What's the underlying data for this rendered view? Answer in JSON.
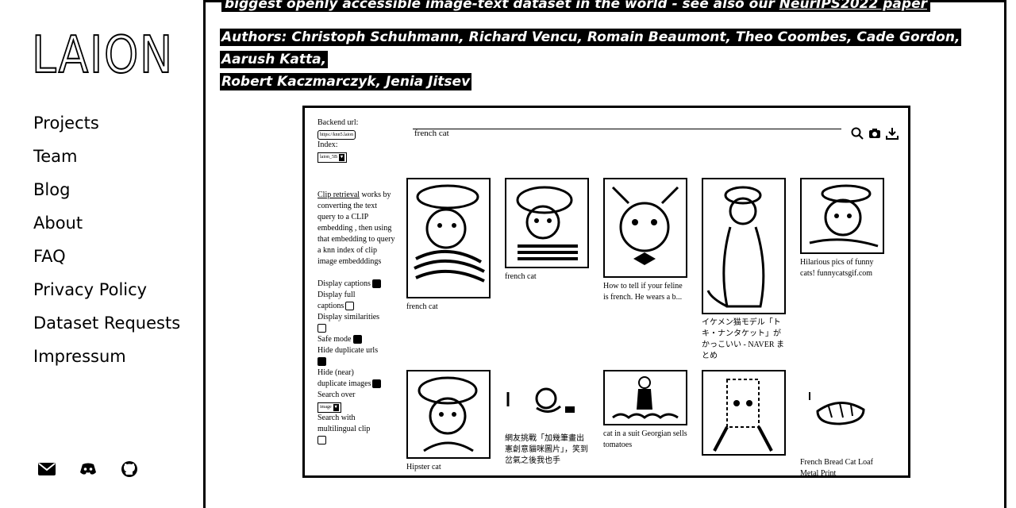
{
  "sidebar": {
    "logo": "LAION",
    "nav": [
      "Projects",
      "Team",
      "Blog",
      "About",
      "FAQ",
      "Privacy Policy",
      "Dataset Requests",
      "Impressum"
    ],
    "social_icons": [
      "mail-icon",
      "discord-icon",
      "github-icon"
    ]
  },
  "article": {
    "intro_text": "biggest openly accessible image-text dataset in the world - see also our ",
    "intro_link": "NeurIPS2022 paper",
    "authors_line1": "Authors: Christoph Schuhmann, Richard Vencu, Romain Beaumont, Theo Coombes, Cade Gordon, Aarush Katta,",
    "authors_line2": "Robert Kaczmarczyk, Jenia Jitsev"
  },
  "figure": {
    "backend_label": "Backend url:",
    "backend_value": "https://knn5.laion",
    "index_label": "Index:",
    "index_value": "laion_5B",
    "query": "french cat",
    "blurb_link": "Clip retrieval",
    "blurb_text": " works by converting the text query to a CLIP embedding , then using that embedding to query a knn index of clip image embedddings",
    "options": {
      "display_captions": "Display captions",
      "display_full": "Display full",
      "captions": "captions",
      "display_similarities": "Display similarities",
      "safe_mode": "Safe mode",
      "hide_duplicate_urls": "Hide duplicate urls",
      "hide_near": "Hide (near)",
      "duplicate_images": "duplicate images",
      "search_over": "Search over",
      "search_over_value": "image",
      "search_with": "Search with",
      "multilingual": "multilingual clip"
    },
    "results": [
      {
        "caption": "french cat"
      },
      {
        "caption": "french cat"
      },
      {
        "caption": "How to tell if your feline is french. He wears a b..."
      },
      {
        "caption": "イケメン猫モデル「トキ・ナンタケット」がかっこいい - NAVER まとめ"
      },
      {
        "caption": "Hilarious pics of funny cats! funnycatsgif.com"
      },
      {
        "caption": "Hipster cat"
      },
      {
        "caption": "網友挑戰「加幾筆畫出憲創意貓咪圖片」，笑到岔氣之後我也手"
      },
      {
        "caption": "cat in a suit Georgian sells tomatoes"
      },
      {
        "caption": ""
      },
      {
        "caption": "French Bread Cat Loaf Metal Print"
      }
    ]
  }
}
